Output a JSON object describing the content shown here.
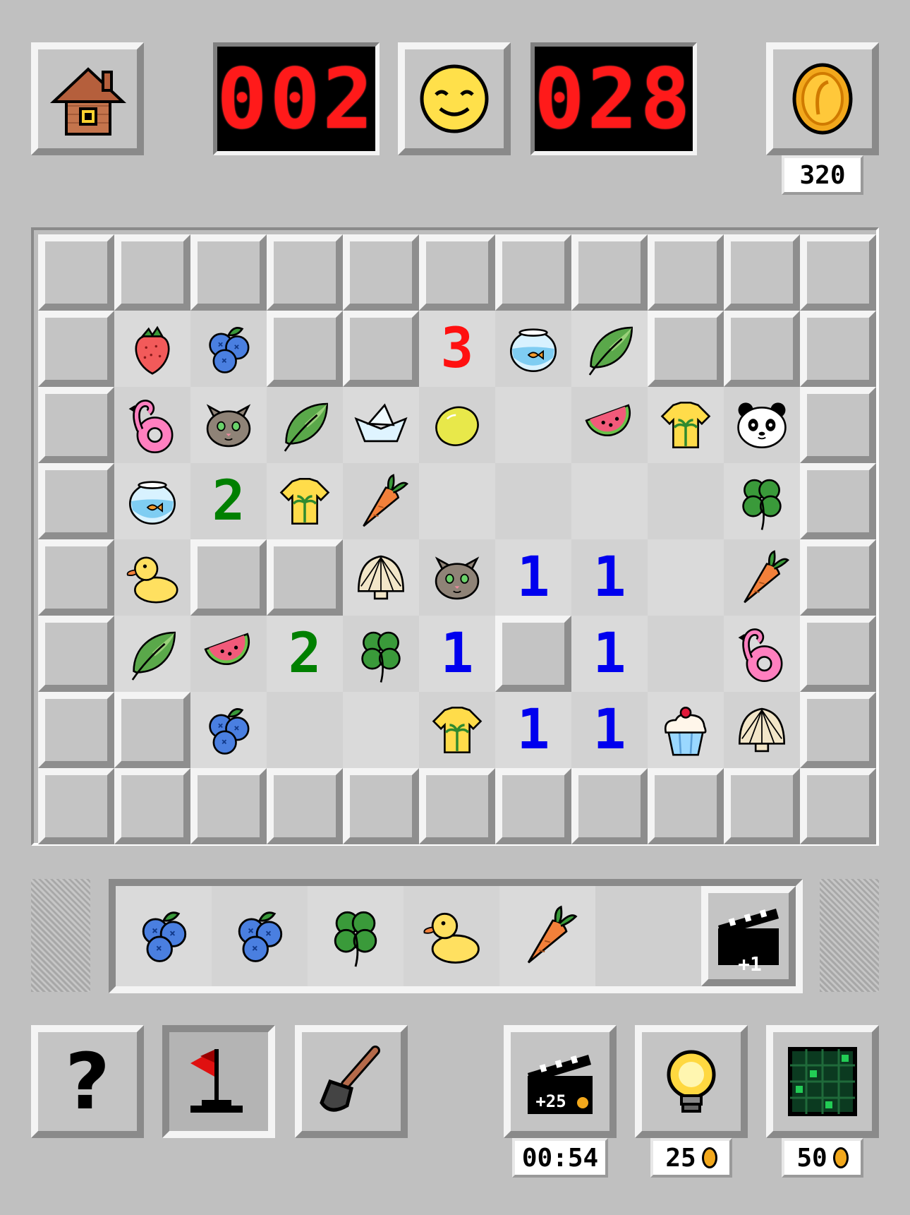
{
  "header": {
    "home_button": {
      "icon": "house-icon"
    },
    "flag_counter": {
      "value": "002"
    },
    "face_button": {
      "icon": "smiley-face-icon"
    },
    "timer_counter": {
      "value": "028"
    },
    "coin_button": {
      "icon": "gold-coin-icon"
    },
    "coins_total": "320"
  },
  "board": {
    "cols": 11,
    "rows": 8,
    "cells": [
      [
        "closed",
        "closed",
        "closed",
        "closed",
        "closed",
        "closed",
        "closed",
        "closed",
        "closed",
        "closed",
        "closed"
      ],
      [
        "closed",
        "strawberry",
        "blueberries",
        "closed",
        "closed",
        "3",
        "fishbowl",
        "leaf",
        "closed",
        "closed",
        "closed"
      ],
      [
        "closed",
        "flamingo-ring",
        "cat",
        "leaf",
        "paper-boat",
        "lemon",
        "",
        "watermelon",
        "shirt",
        "panda",
        "closed"
      ],
      [
        "closed",
        "fishbowl",
        "2",
        "shirt",
        "carrot",
        "",
        "",
        "",
        "",
        "clover",
        "closed"
      ],
      [
        "closed",
        "duck",
        "closed",
        "closed",
        "shell",
        "cat",
        "1",
        "1",
        "",
        "carrot",
        "closed"
      ],
      [
        "closed",
        "leaf",
        "watermelon",
        "2",
        "clover",
        "1",
        "closed",
        "1",
        "",
        "flamingo-ring",
        "closed"
      ],
      [
        "closed",
        "closed",
        "blueberries",
        "",
        "",
        "shirt",
        "1",
        "1",
        "cupcake",
        "shell",
        "closed"
      ],
      [
        "closed",
        "closed",
        "closed",
        "closed",
        "closed",
        "closed",
        "closed",
        "closed",
        "closed",
        "closed",
        "closed"
      ]
    ],
    "number_colors": {
      "1": "#0000ee",
      "2": "#008000",
      "3": "#ff1010"
    }
  },
  "collection_tray": {
    "items": [
      "blueberries",
      "blueberries",
      "clover",
      "duck",
      "carrot"
    ],
    "video_button": {
      "icon": "clapperboard-icon",
      "label": "+1"
    }
  },
  "toolbar": {
    "help_button": {
      "label": "?",
      "icon": "question-mark-icon"
    },
    "flag_tool": {
      "icon": "flag-icon",
      "selected": true
    },
    "shovel_tool": {
      "icon": "shovel-icon"
    },
    "video_reward": {
      "icon": "clapperboard-icon",
      "label": "+25",
      "timer": "00:54"
    },
    "hint_button": {
      "icon": "lightbulb-icon",
      "cost": "25"
    },
    "reveal_button": {
      "icon": "grid-reveal-icon",
      "cost": "50"
    }
  },
  "colors": {
    "background": "#c0c0c0",
    "lcd_red": "#ff1a1a",
    "coin_gold": "#f2a81c"
  }
}
